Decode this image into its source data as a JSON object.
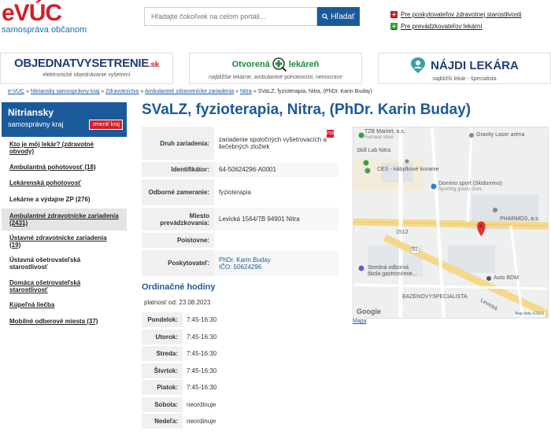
{
  "header": {
    "logo_text": "eVÚC",
    "logo_sub": "samospráva občanom",
    "search_placeholder": "Hľadajte čokoľvek na celom portáli...",
    "search_button": "Hľadať",
    "links": [
      {
        "label": "Pre poskytovateľov zdravotnej starostlivosti",
        "color": "#d0202a"
      },
      {
        "label": "Pre prevádzkovateľov lekární",
        "color": "#3aa03a"
      }
    ]
  },
  "banners": [
    {
      "title_main": "OBJEDNATVYSETRENIE",
      "title_suffix": ".sk",
      "subtitle": "elektronické objednávanie vyšetrení"
    },
    {
      "title_left": "Otvorená",
      "title_right": "lekáreň",
      "subtitle": "najbližšie lekárne, ambulantné pohotovosti, nemocnice"
    },
    {
      "title": "NÁJDI LEKÁRA",
      "subtitle": "najbližší lekár - špecialista"
    }
  ],
  "breadcrumb": [
    "e-VÚC",
    "Nitriansky samosprávny kraj",
    "Zdravotníctvo",
    "Ambulantné zdravotnícke zariadenia",
    "Nitra",
    "SVaLZ, fyzioterapia, Nitra, (PhDr. Karin Buday)"
  ],
  "sidebar": {
    "region": "Nitriansky",
    "region_sub": "samosprávny kraj",
    "change_button": "zmeniť kraj",
    "items": [
      {
        "label": "Kto je môj lekár? (zdravotné obvody)",
        "underline": true,
        "active": false,
        "height": 27
      },
      {
        "label": "Ambulantná pohotovosť (18)",
        "underline": true,
        "active": false,
        "height": 22
      },
      {
        "label": "Lekárenská pohotovosť",
        "underline": true,
        "active": false,
        "height": 19
      },
      {
        "label": "Lekárne a výdajne ZP (276)",
        "underline": false,
        "active": false,
        "height": 23
      },
      {
        "label": "Ambulantné zdravotnícke zariadenia (2431)",
        "underline": true,
        "active": true,
        "height": 28
      },
      {
        "label": "Ústavné zdravotnícke zariadenia (19)",
        "underline": true,
        "active": false,
        "height": 27
      },
      {
        "label": "Ústavná ošetrovateľská starostlivosť",
        "underline": false,
        "active": false,
        "height": 30
      },
      {
        "label": "Domáca ošetrovateľská starostlivosť",
        "underline": true,
        "active": false,
        "height": 28
      },
      {
        "label": "Kúpeľná liečba",
        "underline": true,
        "active": false,
        "height": 19
      },
      {
        "label": "Mobilné odberové miesta (37)",
        "underline": true,
        "active": false,
        "height": 22
      }
    ]
  },
  "main": {
    "title": "SVaLZ, fyzioterapia, Nitra, (PhDr. Karin Buday)",
    "info": [
      {
        "label": "Druh zariadenia:",
        "value": "zariadenie spoločných vyšetrovacích a liečebných zložiek",
        "link": false,
        "h": 42
      },
      {
        "label": "Identifikátor:",
        "value": "64-50624296-A0001",
        "link": false,
        "h": 19
      },
      {
        "label": "Odborné zameranie:",
        "value": "fyzioterapia",
        "link": false,
        "h": 33
      },
      {
        "label": "Miesto prevádzkovania:",
        "value": "Levická 1564/7B 94901 Nitra",
        "link": false,
        "h": 29
      },
      {
        "label": "Poistovne:",
        "value": "",
        "link": false,
        "h": 19
      },
      {
        "label": "Poskytovateľ:",
        "value": "PhDr. Karin Buday",
        "value2": "IČO: 50624296",
        "link": true,
        "h": 33
      }
    ],
    "pdf_icon": "PDF",
    "hours_title": "Ordinačné hodiny",
    "valid_from": "platnosť od: 23.08.2023",
    "hours": [
      {
        "day": "Pondelok:",
        "time": "7:45-16:30"
      },
      {
        "day": "Utorok:",
        "time": "7:45-16:30"
      },
      {
        "day": "Streda:",
        "time": "7:45-16:30"
      },
      {
        "day": "Štvrtok:",
        "time": "7:45-16:30"
      },
      {
        "day": "Piatok:",
        "time": "7:45-16:30"
      },
      {
        "day": "Sobota:",
        "time": "neordinuje"
      },
      {
        "day": "Nedeľa:",
        "time": "neordinuje"
      }
    ]
  },
  "map": {
    "labels": [
      {
        "text": "TZB Market, a.s.",
        "cls": ""
      },
      {
        "text": "Furnace store",
        "cls": "sub"
      },
      {
        "text": "Gravity Laser aréna",
        "cls": ""
      },
      {
        "text": "Skill Lab Nitra",
        "cls": ""
      },
      {
        "text": "CES - nábytkové kovanie",
        "cls": ""
      },
      {
        "text": "Domino sport (Skidomino)",
        "cls": ""
      },
      {
        "text": "Sporting goods store",
        "cls": "sub"
      },
      {
        "text": "PHARMOS, a.s.",
        "cls": ""
      },
      {
        "text": "Stredná odborná",
        "cls": ""
      },
      {
        "text": "škola gastronómie...",
        "cls": ""
      },
      {
        "text": "Auto BDM",
        "cls": ""
      },
      {
        "text": "BAZENOVYSPECIALISTA",
        "cls": ""
      },
      {
        "text": "Levická",
        "cls": ""
      },
      {
        "text": "1512",
        "cls": ""
      },
      {
        "text": "51",
        "cls": ""
      }
    ],
    "google_text": "Google",
    "map_data": "Map data ©2023",
    "link_text": "Mapa"
  }
}
